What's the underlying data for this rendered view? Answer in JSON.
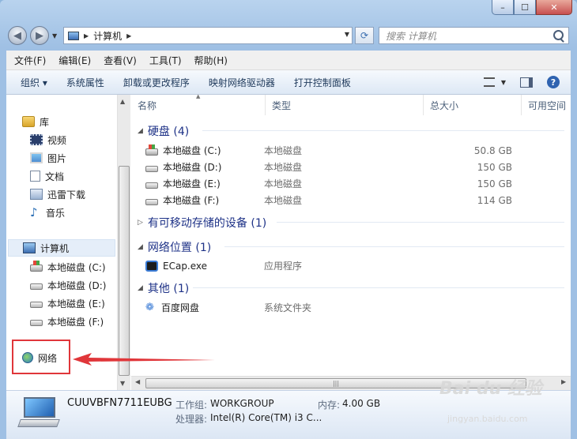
{
  "caption": {
    "min": "–",
    "max": "☐",
    "close": "✕"
  },
  "address": {
    "path": "计算机"
  },
  "search": {
    "placeholder": "搜索 计算机"
  },
  "menu": [
    "文件(F)",
    "编辑(E)",
    "查看(V)",
    "工具(T)",
    "帮助(H)"
  ],
  "commands": [
    "组织 ▾",
    "系统属性",
    "卸载或更改程序",
    "映射网络驱动器",
    "打开控制面板"
  ],
  "sidebar": {
    "library": "库",
    "libraries": [
      "视频",
      "图片",
      "文档",
      "迅雷下载",
      "音乐"
    ],
    "computer": "计算机",
    "drives": [
      "本地磁盘 (C:)",
      "本地磁盘 (D:)",
      "本地磁盘 (E:)",
      "本地磁盘 (F:)"
    ],
    "network": "网络"
  },
  "columns": [
    "名称",
    "类型",
    "总大小",
    "可用空间"
  ],
  "groups": {
    "harddisk": "硬盘 (4)",
    "removable": "有可移动存储的设备 (1)",
    "netloc": "网络位置 (1)",
    "other": "其他 (1)"
  },
  "harddisks": [
    {
      "name": "本地磁盘 (C:)",
      "type": "本地磁盘",
      "size": "50.8 GB"
    },
    {
      "name": "本地磁盘 (D:)",
      "type": "本地磁盘",
      "size": "150 GB"
    },
    {
      "name": "本地磁盘 (E:)",
      "type": "本地磁盘",
      "size": "150 GB"
    },
    {
      "name": "本地磁盘 (F:)",
      "type": "本地磁盘",
      "size": "114 GB"
    }
  ],
  "netitems": [
    {
      "name": "ECap.exe",
      "type": "应用程序"
    }
  ],
  "otheritems": [
    {
      "name": "百度网盘",
      "type": "系统文件夹"
    }
  ],
  "details": {
    "pcname": "CUUVBFN7711EUBG",
    "workgroup_label": "工作组:",
    "workgroup": "WORKGROUP",
    "memory_label": "内存:",
    "memory": "4.00 GB",
    "cpu_label": "处理器:",
    "cpu": "Intel(R) Core(TM) i3 C..."
  },
  "watermark": {
    "logo": "Bai du 经验",
    "url": "jingyan.baidu.com"
  },
  "colors": {
    "annotation": "#e0363a",
    "group_header": "#1e3287"
  }
}
